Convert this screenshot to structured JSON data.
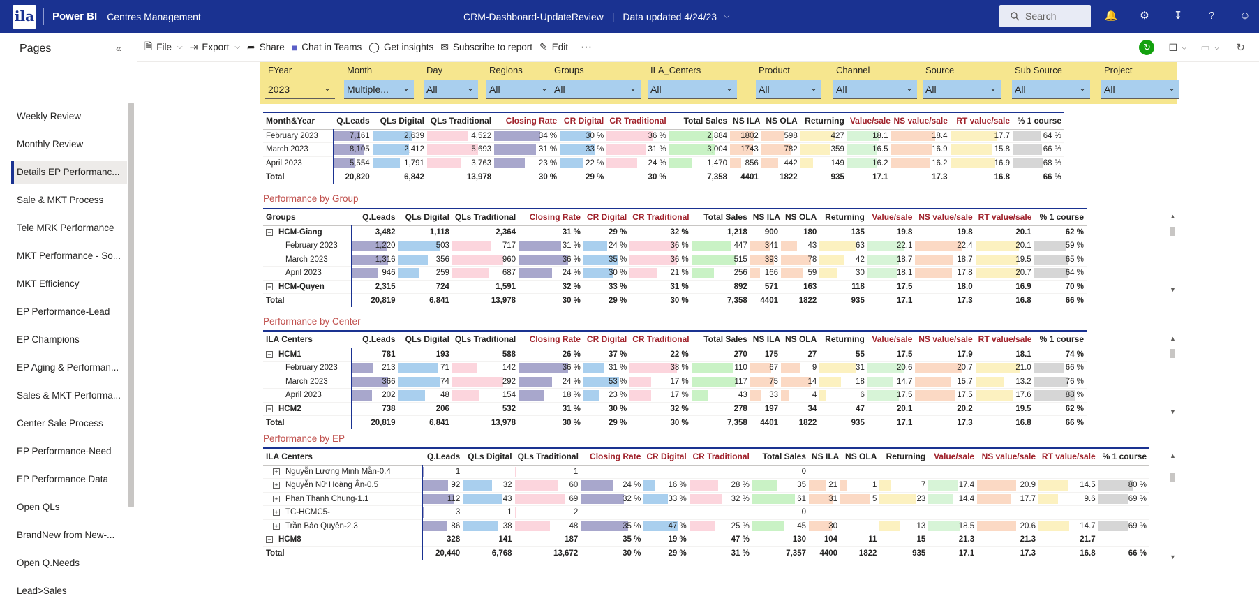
{
  "topbar": {
    "logo": "ila",
    "app": "Power BI",
    "workspace": "Centres Management",
    "report": "CRM-Dashboard-UpdateReview",
    "separator": "|",
    "updated": "Data updated 4/24/23",
    "search_placeholder": "Search"
  },
  "pages": {
    "title": "Pages",
    "items": [
      "Weekly Review",
      "Monthly Review",
      "Details EP Performanc...",
      "Sale & MKT Process",
      "Tele MRK Performance",
      "MKT Performance - So...",
      "MKT Efficiency",
      "EP Performance-Lead",
      "EP Champions",
      "EP Aging & Performan...",
      "Sales & MKT Performa...",
      "Center Sale Process",
      "EP Performance-Need",
      "EP Performance Data",
      "Open QLs",
      "BrandNew from New-...",
      "Open Q.Needs",
      "Lead>Sales"
    ],
    "active_index": 2
  },
  "actions": {
    "file": "File",
    "export": "Export",
    "share": "Share",
    "teams": "Chat in Teams",
    "insights": "Get insights",
    "subscribe": "Subscribe to report",
    "edit": "Edit"
  },
  "slicers": [
    {
      "label": "FYear",
      "value": "2023"
    },
    {
      "label": "Month",
      "value": "Multiple..."
    },
    {
      "label": "Day",
      "value": "All"
    },
    {
      "label": "Regions",
      "value": "All"
    },
    {
      "label": "Groups",
      "value": "All"
    },
    {
      "label": "ILA_Centers",
      "value": "All"
    },
    {
      "label": "Product",
      "value": "All"
    },
    {
      "label": "Channel",
      "value": "All"
    },
    {
      "label": "Source",
      "value": "All"
    },
    {
      "label": "Sub Source",
      "value": "All"
    },
    {
      "label": "Project",
      "value": "All"
    }
  ],
  "colors": {
    "leads": "#a8a7cc",
    "qld": "#a9cfee",
    "qlt": "#fcd5dd",
    "closing": "#a8a7cc",
    "crd": "#a9cfee",
    "crt": "#fcd5dd",
    "sales": "#c9f2c5",
    "nsila": "#fbd9c4",
    "returning": "#fcf1c0",
    "value": "#d7f4d7",
    "nsvalue": "#fbd9c4",
    "rtvalue": "#fcf1c0",
    "one": "#d6d6d6"
  },
  "headers": {
    "cols": [
      "Q.Leads",
      "QLs Digital",
      "QLs Traditional",
      "Closing Rate",
      "CR Digital",
      "CR Traditional",
      "Total Sales",
      "NS ILA",
      "NS OLA",
      "Returning",
      "Value/sale",
      "NS value/sale",
      "RT value/sale",
      "% 1 course"
    ]
  },
  "table1": {
    "first_header": "Month&Year",
    "rows": [
      {
        "name": "February 2023",
        "v": [
          "7,161",
          "2,639",
          "4,522",
          "34 %",
          "30 %",
          "36 %",
          "2,884",
          "1802",
          "598",
          "427",
          "18.1",
          "18.4",
          "17.7",
          "64 %"
        ],
        "f": [
          0.88,
          0.96,
          0.8,
          0.92,
          0.88,
          0.96,
          0.96,
          1,
          0.76,
          0.98,
          0.98,
          0.98,
          0.98,
          0.72
        ]
      },
      {
        "name": "March 2023",
        "v": [
          "8,105",
          "2,412",
          "5,693",
          "31 %",
          "33 %",
          "31 %",
          "3,004",
          "1743",
          "782",
          "359",
          "16.5",
          "16.9",
          "15.8",
          "66 %"
        ],
        "f": [
          1,
          0.88,
          1,
          0.84,
          0.98,
          0.82,
          1,
          0.96,
          1,
          0.84,
          0.9,
          0.9,
          0.88,
          0.74
        ]
      },
      {
        "name": "April 2023",
        "v": [
          "5,554",
          "1,791",
          "3,763",
          "23 %",
          "22 %",
          "24 %",
          "1,470",
          "856",
          "442",
          "149",
          "16.2",
          "16.2",
          "16.9",
          "68 %"
        ],
        "f": [
          0.7,
          0.66,
          0.66,
          0.62,
          0.66,
          0.64,
          0.5,
          0.48,
          0.56,
          0.35,
          0.88,
          0.86,
          0.95,
          0.78
        ]
      }
    ],
    "total": {
      "name": "Total",
      "v": [
        "20,820",
        "6,842",
        "13,978",
        "30 %",
        "29 %",
        "30 %",
        "7,358",
        "4401",
        "1822",
        "935",
        "17.1",
        "17.3",
        "16.8",
        "66 %"
      ]
    }
  },
  "table2": {
    "title": "Performance by Group",
    "first_header": "Groups",
    "rows": [
      {
        "type": "group",
        "name": "HCM-Giang",
        "v": [
          "3,482",
          "1,118",
          "2,364",
          "31 %",
          "29 %",
          "32 %",
          "1,218",
          "900",
          "180",
          "135",
          "19.8",
          "19.8",
          "20.1",
          "62 %"
        ]
      },
      {
        "type": "sub",
        "name": "February 2023",
        "v": [
          "1,220",
          "503",
          "717",
          "31 %",
          "24 %",
          "36 %",
          "447",
          "341",
          "43",
          "63",
          "22.1",
          "22.4",
          "20.1",
          "59 %"
        ],
        "f": [
          0.95,
          1,
          0.75,
          0.86,
          0.67,
          1,
          0.87,
          0.87,
          0.55,
          1,
          1,
          1,
          0.97,
          0.78
        ]
      },
      {
        "type": "sub",
        "name": "March 2023",
        "v": [
          "1,316",
          "356",
          "960",
          "36 %",
          "35 %",
          "36 %",
          "515",
          "393",
          "78",
          "42",
          "18.7",
          "18.7",
          "19.5",
          "65 %"
        ],
        "f": [
          1,
          0.71,
          1,
          1,
          0.97,
          1,
          1,
          1,
          1,
          0.67,
          0.85,
          0.83,
          0.94,
          0.86
        ]
      },
      {
        "type": "sub",
        "name": "April 2023",
        "v": [
          "946",
          "259",
          "687",
          "24 %",
          "30 %",
          "21 %",
          "256",
          "166",
          "59",
          "30",
          "18.1",
          "17.8",
          "20.7",
          "64 %"
        ],
        "f": [
          0.72,
          0.51,
          0.72,
          0.67,
          0.83,
          0.58,
          0.5,
          0.42,
          0.76,
          0.48,
          0.82,
          0.79,
          1,
          0.85
        ]
      },
      {
        "type": "group",
        "name": "HCM-Quyen",
        "v": [
          "2,315",
          "724",
          "1,591",
          "32 %",
          "33 %",
          "31 %",
          "892",
          "571",
          "163",
          "118",
          "17.5",
          "18.0",
          "16.9",
          "70 %"
        ]
      }
    ],
    "total": {
      "name": "Total",
      "v": [
        "20,819",
        "6,841",
        "13,978",
        "30 %",
        "29 %",
        "30 %",
        "7,358",
        "4401",
        "1822",
        "935",
        "17.1",
        "17.3",
        "16.8",
        "66 %"
      ]
    }
  },
  "table3": {
    "title": "Performance by Center",
    "first_header": "ILA Centers",
    "rows": [
      {
        "type": "group",
        "name": "HCM1",
        "v": [
          "781",
          "193",
          "588",
          "26 %",
          "37 %",
          "22 %",
          "270",
          "175",
          "27",
          "55",
          "17.5",
          "17.9",
          "18.1",
          "74 %"
        ]
      },
      {
        "type": "sub",
        "name": "February 2023",
        "v": [
          "213",
          "71",
          "142",
          "36 %",
          "31 %",
          "38 %",
          "110",
          "67",
          "9",
          "31",
          "20.6",
          "20.7",
          "21.0",
          "66 %"
        ],
        "f": [
          0.58,
          0.96,
          0.49,
          1,
          0.58,
          1,
          0.94,
          0.89,
          0.64,
          1,
          1,
          1,
          1,
          0.75
        ]
      },
      {
        "type": "sub",
        "name": "March 2023",
        "v": [
          "366",
          "74",
          "292",
          "24 %",
          "53 %",
          "17 %",
          "117",
          "75",
          "14",
          "18",
          "14.7",
          "15.7",
          "13.2",
          "76 %"
        ],
        "f": [
          1,
          1,
          1,
          0.67,
          1,
          0.45,
          1,
          1,
          1,
          0.58,
          0.71,
          0.76,
          0.63,
          0.86
        ]
      },
      {
        "type": "sub",
        "name": "April 2023",
        "v": [
          "202",
          "48",
          "154",
          "18 %",
          "23 %",
          "17 %",
          "43",
          "33",
          "4",
          "6",
          "17.5",
          "17.5",
          "17.6",
          "88 %"
        ],
        "f": [
          0.55,
          0.65,
          0.53,
          0.5,
          0.43,
          0.45,
          0.37,
          0.44,
          0.29,
          0.19,
          0.85,
          0.85,
          0.84,
          1
        ]
      },
      {
        "type": "group",
        "name": "HCM2",
        "v": [
          "738",
          "206",
          "532",
          "31 %",
          "30 %",
          "32 %",
          "278",
          "197",
          "34",
          "47",
          "20.1",
          "20.2",
          "19.5",
          "62 %"
        ]
      }
    ],
    "total": {
      "name": "Total",
      "v": [
        "20,819",
        "6,841",
        "13,978",
        "30 %",
        "29 %",
        "30 %",
        "7,358",
        "4401",
        "1822",
        "935",
        "17.1",
        "17.3",
        "16.8",
        "66 %"
      ]
    }
  },
  "table4": {
    "title": "Performance by EP",
    "first_header": "ILA Centers",
    "rows": [
      {
        "type": "ep",
        "name": "Nguyễn Lương Minh Mẫn-0.4",
        "v": [
          "1",
          "",
          "1",
          "",
          "",
          "",
          "0",
          "",
          "",
          "",
          "",
          "",
          "",
          ""
        ],
        "f": [
          0.01,
          0,
          0.01,
          0,
          0,
          0,
          0,
          0,
          0,
          0,
          0,
          0,
          0,
          0
        ]
      },
      {
        "type": "ep",
        "name": "Nguyễn Nữ Hoàng Ân-0.5",
        "v": [
          "92",
          "32",
          "60",
          "24 %",
          "16 %",
          "28 %",
          "35",
          "21",
          "1",
          "7",
          "17.4",
          "20.9",
          "14.5",
          "80 %"
        ],
        "f": [
          0.82,
          0.74,
          0.87,
          0.69,
          0.34,
          0.6,
          0.57,
          0.7,
          0.2,
          0.3,
          0.8,
          0.85,
          0.67,
          0.9
        ]
      },
      {
        "type": "ep",
        "name": "Phan Thanh Chung-1.1",
        "v": [
          "112",
          "43",
          "69",
          "32 %",
          "33 %",
          "32 %",
          "61",
          "31",
          "5",
          "23",
          "14.4",
          "17.7",
          "9.6",
          "69 %"
        ],
        "f": [
          1,
          1,
          1,
          0.91,
          0.7,
          0.68,
          1,
          1,
          1,
          1,
          0.66,
          0.72,
          0.44,
          0.78
        ]
      },
      {
        "type": "ep",
        "name": "TC-HCMC5-",
        "v": [
          "3",
          "1",
          "2",
          "",
          "",
          "",
          "0",
          "",
          "",
          "",
          "",
          "",
          "",
          ""
        ],
        "f": [
          0.03,
          0.02,
          0.03,
          0,
          0,
          0,
          0,
          0,
          0,
          0,
          0,
          0,
          0,
          0
        ]
      },
      {
        "type": "ep",
        "name": "Trần Bảo Quyên-2.3",
        "v": [
          "86",
          "38",
          "48",
          "35 %",
          "47 %",
          "25 %",
          "45",
          "30",
          "",
          "13",
          "18.5",
          "20.6",
          "14.7",
          "69 %"
        ],
        "f": [
          0.77,
          0.88,
          0.7,
          1,
          1,
          0.53,
          0.74,
          0.97,
          0,
          0.57,
          0.85,
          0.84,
          0.68,
          0.78
        ]
      },
      {
        "type": "group",
        "name": "HCM8",
        "v": [
          "328",
          "141",
          "187",
          "35 %",
          "19 %",
          "47 %",
          "130",
          "104",
          "11",
          "15",
          "21.3",
          "21.3",
          "21.7",
          ""
        ]
      }
    ],
    "total": {
      "name": "Total",
      "v": [
        "20,440",
        "6,768",
        "13,672",
        "30 %",
        "29 %",
        "31 %",
        "7,357",
        "4400",
        "1822",
        "935",
        "17.1",
        "17.3",
        "16.8",
        "66 %"
      ]
    }
  }
}
